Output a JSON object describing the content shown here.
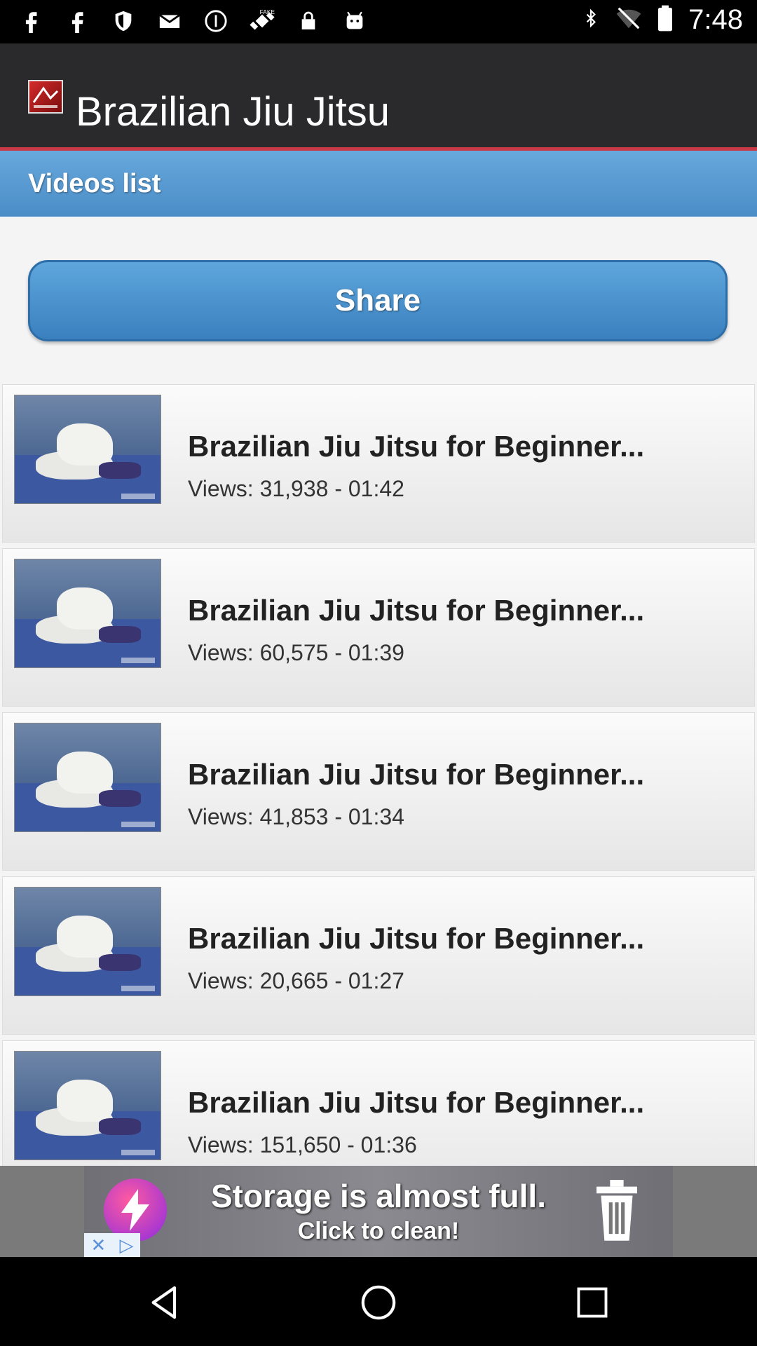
{
  "status_bar": {
    "time": "7:48",
    "left_icons": [
      "facebook-icon",
      "facebook-icon",
      "shield-icon",
      "mail-icon",
      "coin-icon",
      "satellite-icon",
      "lock-icon",
      "android-icon"
    ],
    "fake_gps_label": "FAKE",
    "right_icons": [
      "bluetooth-icon",
      "wifi-off-icon",
      "battery-icon"
    ]
  },
  "app_bar": {
    "title": "Brazilian Jiu Jitsu",
    "logo_text": "JIU-JITSU"
  },
  "section": {
    "title": "Videos list"
  },
  "share_button": {
    "label": "Share"
  },
  "videos": [
    {
      "title": "Brazilian Jiu Jitsu for Beginner...",
      "meta": "Views: 31,938 - 01:42"
    },
    {
      "title": "Brazilian Jiu Jitsu for Beginner...",
      "meta": "Views: 60,575 - 01:39"
    },
    {
      "title": "Brazilian Jiu Jitsu for Beginner...",
      "meta": "Views: 41,853 - 01:34"
    },
    {
      "title": "Brazilian Jiu Jitsu for Beginner...",
      "meta": "Views: 20,665 - 01:27"
    },
    {
      "title": "Brazilian Jiu Jitsu for Beginner...",
      "meta": "Views: 151,650 - 01:36"
    }
  ],
  "ad": {
    "line1": "Storage is almost full.",
    "line2": "Click to clean!"
  },
  "colors": {
    "action_bar": "#2a2a2d",
    "accent_line": "#c83a48",
    "header_blue": "#5a9bd1",
    "share_blue": "#3a80bf"
  }
}
